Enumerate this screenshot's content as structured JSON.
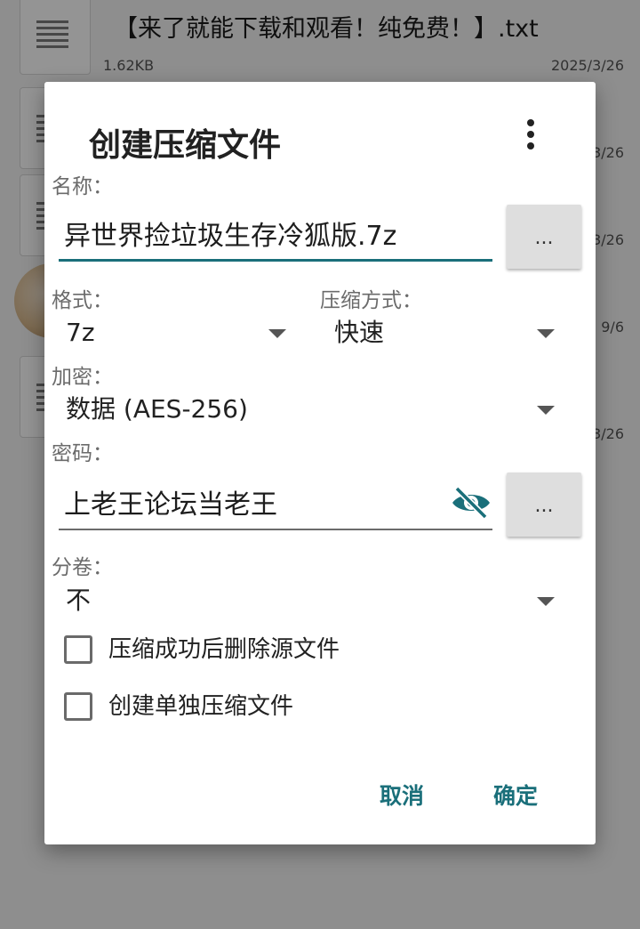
{
  "background_files": [
    {
      "name": "【来了就能下载和观看！纯免费！】.txt",
      "size": "1.62KB",
      "date": "2025/3/26",
      "icon": "text-file-icon"
    },
    {
      "name": "",
      "size": "",
      "date": "3/26",
      "icon": "text-file-icon"
    },
    {
      "name": "",
      "size": "",
      "date": "3/26",
      "icon": "text-file-icon"
    },
    {
      "name": "",
      "size": "",
      "date": "9/6",
      "icon": "image-thumbnail"
    },
    {
      "name": "",
      "size": "",
      "date": "3/26",
      "icon": "text-file-icon"
    }
  ],
  "dialog": {
    "title": "创建压缩文件",
    "more_icon": "more-vert-icon",
    "name_label": "名称：",
    "name_value": "异世界捡垃圾生存冷狐版.7z",
    "browse_label": "...",
    "format_label": "格式：",
    "format_value": "7z",
    "method_label": "压缩方式：",
    "method_value": "快速",
    "encryption_label": "加密：",
    "encryption_value": "数据 (AES-256)",
    "password_label": "密码：",
    "password_value": "上老王论坛当老王",
    "password_visibility_icon": "visibility-off-icon",
    "password_browse_label": "...",
    "split_label": "分卷：",
    "split_value": "不",
    "delete_source_label": "压缩成功后删除源文件",
    "delete_source_checked": false,
    "separate_archives_label": "创建单独压缩文件",
    "separate_archives_checked": false,
    "cancel_label": "取消",
    "ok_label": "确定"
  },
  "colors": {
    "accent": "#1a6f7a",
    "scrim": "rgba(0,0,0,0.42)"
  }
}
